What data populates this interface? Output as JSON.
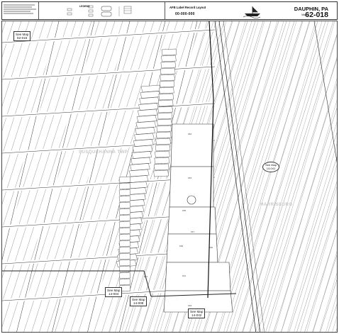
{
  "title_block": {
    "legend_title": "LEGEND",
    "brand_line1": "AFB Label Record Layout",
    "brand_line2": "00-000-000",
    "county_state": "DAUPHIN, PA",
    "map_label": "Map #",
    "map_number": "62-018",
    "logo_icon": "ship-logo-icon"
  },
  "map": {
    "see_maps": {
      "top_left": "See Map\n62-015",
      "right": "See Map\n14-041",
      "bottom_left_a": "See Map\n14-004",
      "bottom_left_b": "See Map\n14-008",
      "bottom_center": "See Map\n14-042"
    },
    "watermarks": {
      "left": "SUSQUEHANNA TWP",
      "right": "HARRISBURG"
    }
  }
}
